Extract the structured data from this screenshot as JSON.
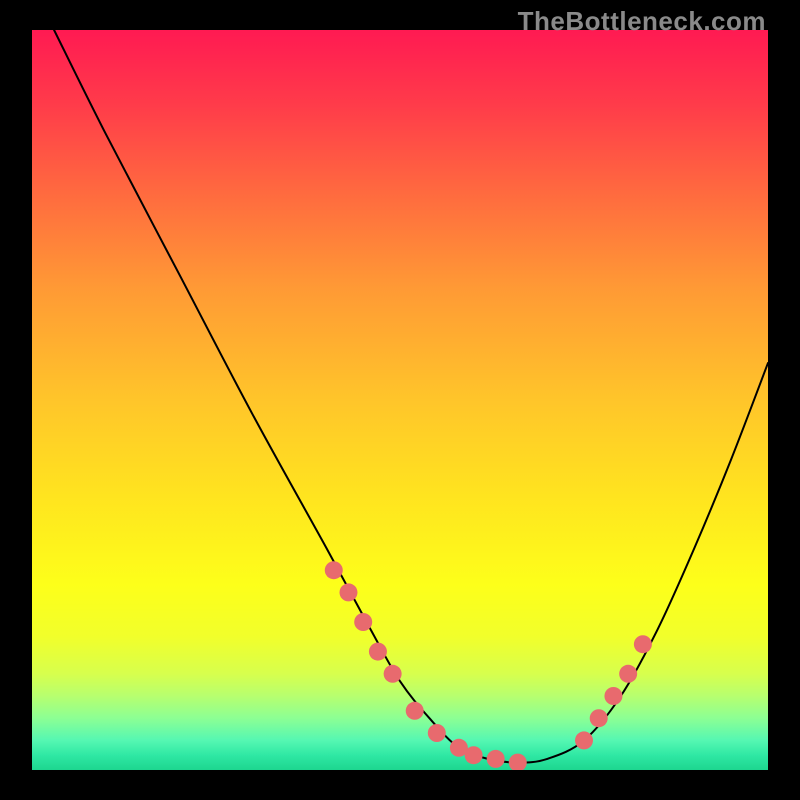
{
  "watermark": "TheBottleneck.com",
  "chart_data": {
    "type": "line",
    "title": "",
    "xlabel": "",
    "ylabel": "",
    "xlim": [
      0,
      100
    ],
    "ylim": [
      0,
      100
    ],
    "series": [
      {
        "name": "curve",
        "x": [
          3,
          10,
          20,
          30,
          40,
          46,
          50,
          54,
          58,
          62,
          66,
          70,
          75,
          80,
          85,
          90,
          95,
          100
        ],
        "y": [
          100,
          86,
          67,
          48,
          30,
          19,
          12,
          7,
          3,
          1.5,
          1,
          1.5,
          4,
          10,
          19,
          30,
          42,
          55
        ]
      }
    ],
    "highlight_dots": {
      "left_cluster_x": [
        41,
        43,
        45,
        47,
        49,
        52,
        55,
        58,
        60,
        63,
        66
      ],
      "left_cluster_y": [
        27,
        24,
        20,
        16,
        13,
        8,
        5,
        3,
        2,
        1.5,
        1
      ],
      "right_cluster_x": [
        75,
        77,
        79,
        81,
        83
      ],
      "right_cluster_y": [
        4,
        7,
        10,
        13,
        17
      ]
    },
    "colors": {
      "curve": "#000000",
      "dots": "#e86a6e"
    }
  }
}
